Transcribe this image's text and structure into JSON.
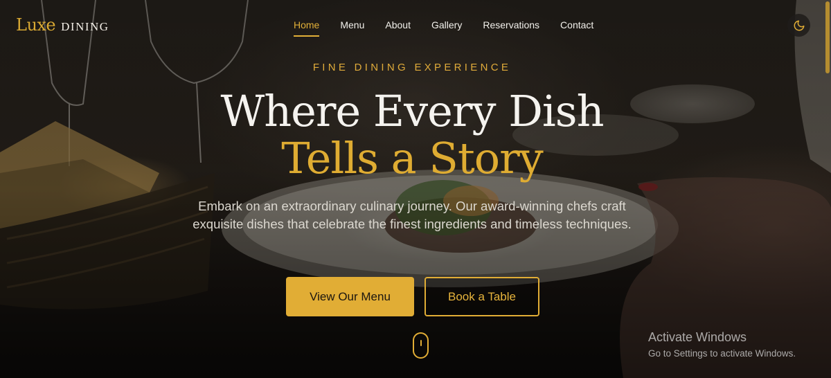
{
  "brand": {
    "script": "Luxe",
    "word": "DINING"
  },
  "nav": {
    "items": [
      {
        "label": "Home",
        "active": true
      },
      {
        "label": "Menu"
      },
      {
        "label": "About"
      },
      {
        "label": "Gallery"
      },
      {
        "label": "Reservations"
      },
      {
        "label": "Contact"
      }
    ],
    "theme_toggle_icon": "moon-icon"
  },
  "hero": {
    "eyebrow": "FINE DINING EXPERIENCE",
    "title_line1": "Where Every Dish",
    "title_line2": "Tells a Story",
    "subtitle": "Embark on an extraordinary culinary journey. Our award-winning chefs craft exquisite dishes that celebrate the finest ingredients and timeless techniques.",
    "primary_button": "View Our Menu",
    "secondary_button": "Book a Table",
    "scroll_icon": "mouse-scroll-icon"
  },
  "watermark": {
    "title": "Activate Windows",
    "subtitle": "Go to Settings to activate Windows."
  },
  "colors": {
    "accent": "#e1ad35",
    "text_light": "#f5f3ef",
    "background": "#161310"
  }
}
